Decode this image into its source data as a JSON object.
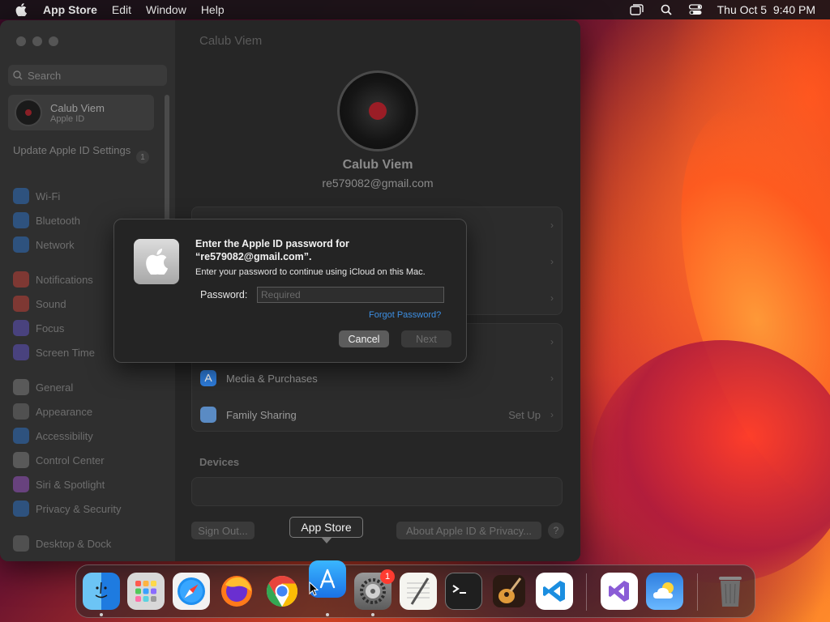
{
  "menubar": {
    "app_name": "App Store",
    "menus": [
      "Edit",
      "Window",
      "Help"
    ],
    "datetime": "Thu Oct 5  9:40 PM"
  },
  "sidebar": {
    "search_placeholder": "Search",
    "account_name": "Calub Viem",
    "account_sub": "Apple ID",
    "update_text": "Update Apple ID Settings",
    "update_badge": "1",
    "items": [
      {
        "label": "Wi-Fi",
        "color": "#2f7fe0"
      },
      {
        "label": "Bluetooth",
        "color": "#2f7fe0"
      },
      {
        "label": "Network",
        "color": "#2f7fe0"
      },
      {
        "label": "Notifications",
        "color": "#e0443a"
      },
      {
        "label": "Sound",
        "color": "#e0443a"
      },
      {
        "label": "Focus",
        "color": "#6b5ce0"
      },
      {
        "label": "Screen Time",
        "color": "#6b5ce0"
      },
      {
        "label": "General",
        "color": "#8e8e8e"
      },
      {
        "label": "Appearance",
        "color": "#3a3a3a"
      },
      {
        "label": "Accessibility",
        "color": "#2f7fe0"
      },
      {
        "label": "Control Center",
        "color": "#8e8e8e"
      },
      {
        "label": "Siri & Spotlight",
        "color": "#b05ae0"
      },
      {
        "label": "Privacy & Security",
        "color": "#2f7fe0"
      },
      {
        "label": "Desktop & Dock",
        "color": "#3a3a3a"
      }
    ]
  },
  "content": {
    "title": "Calub Viem",
    "name": "Calub Viem",
    "email": "re579082@gmail.com",
    "rows": [
      {
        "label": "Media & Purchases",
        "detail": ""
      },
      {
        "label": "Family Sharing",
        "detail": "Set Up"
      }
    ],
    "devices_title": "Devices",
    "sign_out": "Sign Out...",
    "about": "About Apple ID & Privacy...",
    "help": "?"
  },
  "dialog": {
    "title": "Enter the Apple ID password for “re579082@gmail.com”.",
    "message": "Enter your password to continue using iCloud on this Mac.",
    "password_label": "Password:",
    "password_placeholder": "Required",
    "password_value": "",
    "forgot": "Forgot Password?",
    "cancel": "Cancel",
    "next": "Next"
  },
  "tooltip": "App Store",
  "dock": {
    "apps": [
      {
        "name": "Finder",
        "icon": "finder-icon"
      },
      {
        "name": "Launchpad",
        "icon": "launchpad-icon"
      },
      {
        "name": "Safari",
        "icon": "safari-icon"
      },
      {
        "name": "Firefox",
        "icon": "firefox-icon"
      },
      {
        "name": "Chrome",
        "icon": "chrome-icon"
      },
      {
        "name": "App Store",
        "icon": "app-store-icon"
      },
      {
        "name": "System Settings",
        "icon": "system-settings-icon",
        "badge": "1"
      },
      {
        "name": "TextEdit",
        "icon": "textedit-icon"
      },
      {
        "name": "Terminal",
        "icon": "terminal-icon"
      },
      {
        "name": "GarageBand",
        "icon": "garageband-icon"
      },
      {
        "name": "Visual Studio Code",
        "icon": "vscode-icon"
      },
      {
        "name": "Visual Studio",
        "icon": "visual-studio-icon"
      },
      {
        "name": "Weather",
        "icon": "weather-icon"
      },
      {
        "name": "Trash",
        "icon": "trash-icon"
      }
    ]
  }
}
